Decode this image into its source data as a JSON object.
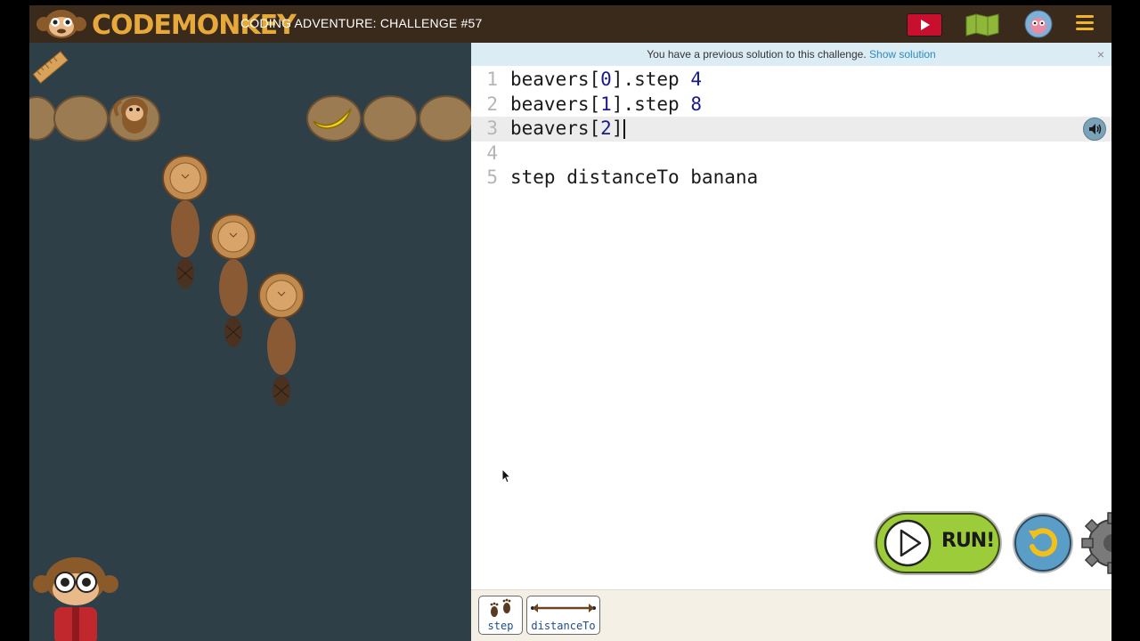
{
  "header": {
    "logo_text": "codemonkey",
    "challenge_title": "CODING ADVENTURE: CHALLENGE #57",
    "icons": [
      "video-icon",
      "map-icon",
      "avatar-icon",
      "menu-icon"
    ]
  },
  "notice": {
    "message": "You have a previous solution to this challenge.",
    "link": "Show solution",
    "close": "×"
  },
  "editor": {
    "lines": [
      {
        "number": "1",
        "code": "beavers[0].step 4"
      },
      {
        "number": "2",
        "code": "beavers[1].step 8"
      },
      {
        "number": "3",
        "code": "beavers[2]"
      },
      {
        "number": "4",
        "code": ""
      },
      {
        "number": "5",
        "code": "step distanceTo banana"
      }
    ],
    "active_line": 3
  },
  "controls": {
    "run_label": "RUN!"
  },
  "palette": {
    "tiles": [
      {
        "label": "step",
        "icon": "footprints-icon"
      },
      {
        "label": "distanceTo",
        "icon": "double-arrow-icon"
      }
    ]
  },
  "colors": {
    "topbar": "#3a2a1c",
    "logo": "#e6a93a",
    "game_bg": "#2f3f48",
    "run_button": "#9ccc3a",
    "notice_bg": "#dcecf4",
    "link": "#2b8cc4"
  }
}
